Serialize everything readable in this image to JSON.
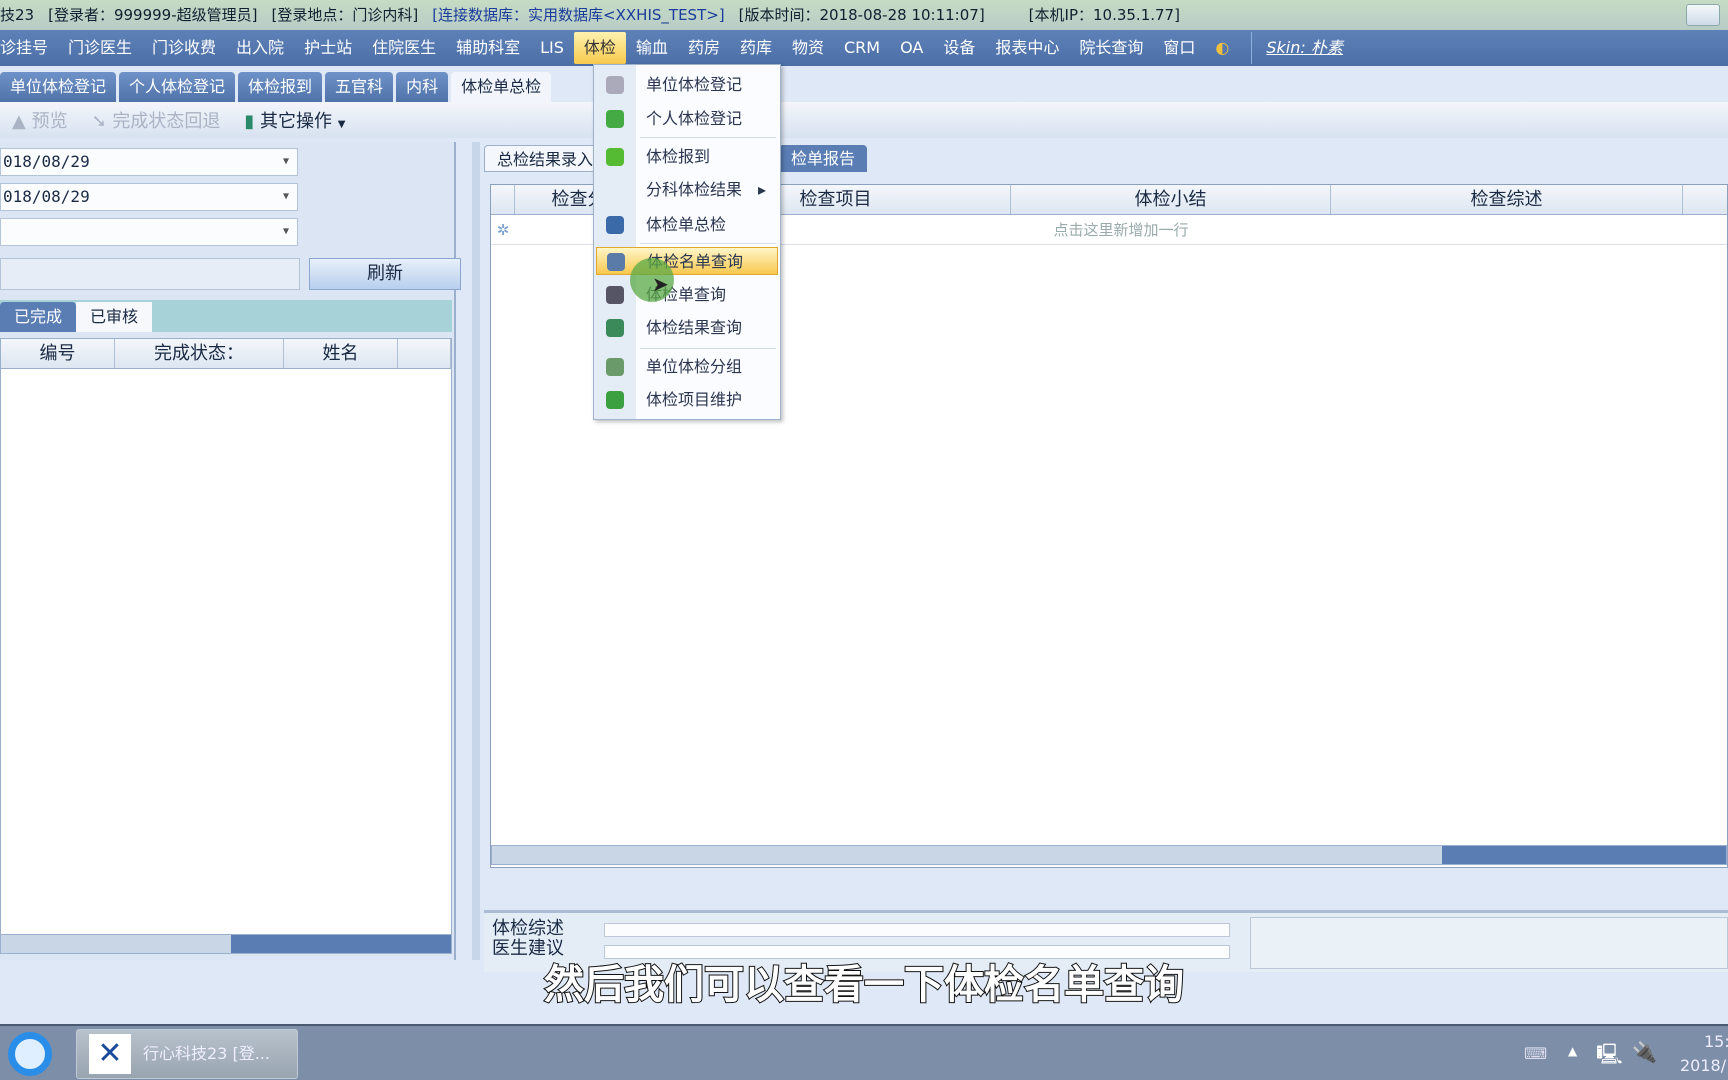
{
  "titlebar": {
    "segments": [
      "技23",
      "[登录者：999999-超级管理员]",
      "[登录地点：门诊内科]",
      "[连接数据库：实用数据库<XXHIS_TEST>]",
      "[版本时间：2018-08-28 10:11:07]",
      "[本机IP：10.35.1.77]"
    ]
  },
  "menubar": {
    "items": [
      "诊挂号",
      "门诊医生",
      "门诊收费",
      "出入院",
      "护士站",
      "住院医生",
      "辅助科室",
      "LIS",
      "体检",
      "输血",
      "药房",
      "药库",
      "物资",
      "CRM",
      "OA",
      "设备",
      "报表中心",
      "院长查询",
      "窗口"
    ],
    "active": "体检",
    "skin": "Skin: 朴素"
  },
  "tabs": [
    "单位体检登记",
    "个人体检登记",
    "体检报到",
    "五官科",
    "内科",
    "体检单总检"
  ],
  "toolbar": {
    "preview": "预览",
    "rollback": "完成状态回退",
    "other": "其它操作"
  },
  "left": {
    "date1": "018/08/29",
    "date2": "018/08/29",
    "combo3": "",
    "search": "",
    "refresh": "刷新",
    "tabs": [
      "已完成",
      "已审核"
    ],
    "columns": [
      "编号",
      "完成状态：",
      "姓名",
      ""
    ]
  },
  "right": {
    "tabs": [
      "总检结果录入",
      "检单报告"
    ],
    "columns": [
      "检查分类",
      "检查项目",
      "体检小结",
      "检查综述"
    ],
    "new_row": "点击这里新增加一行",
    "summary_label": "体检综述",
    "advice_label": "医生建议"
  },
  "dropdown": {
    "items": [
      {
        "label": "单位体检登记",
        "icon": "gears-icon"
      },
      {
        "label": "个人体检登记",
        "icon": "arrow-up-icon"
      },
      {
        "label": "体检报到",
        "icon": "arrow-down-icon"
      },
      {
        "label": "分科体检结果",
        "icon": "",
        "submenu": true
      },
      {
        "label": "体检单总检",
        "icon": "doctor-icon"
      },
      {
        "label": "体检名单查询",
        "icon": "doctor-list-icon",
        "highlighted": true
      },
      {
        "label": "体检单查询",
        "icon": "person-search-icon"
      },
      {
        "label": "体检结果查询",
        "icon": "person-result-icon"
      },
      {
        "label": "单位体检分组",
        "icon": "group-icon"
      },
      {
        "label": "体检项目维护",
        "icon": "maintenance-icon"
      }
    ]
  },
  "subtitle": "然后我们可以查看一下体检名单查询",
  "taskbar": {
    "app": "行心科技23 [登...",
    "clock_time": "15:",
    "clock_date": "2018/"
  },
  "colors": {
    "menubar": "#4b6ea6",
    "highlight": "#f8c84e",
    "tab": "#5a7db4"
  }
}
